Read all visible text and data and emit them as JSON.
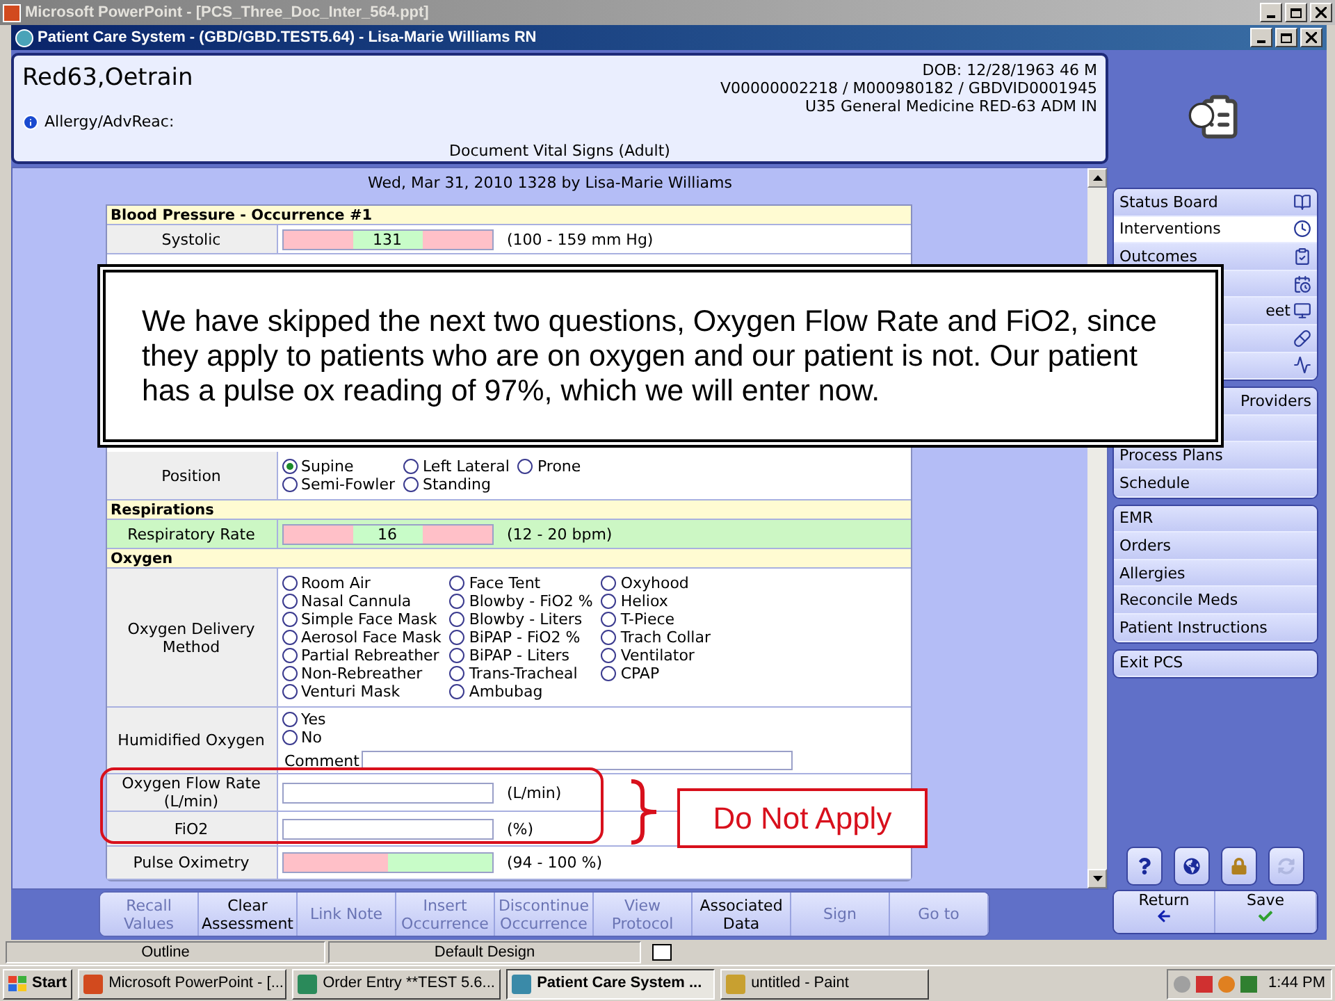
{
  "ppt_window": {
    "title": "Microsoft PowerPoint - [PCS_Three_Doc_Inter_564.ppt]"
  },
  "pcs_window": {
    "title": "Patient Care System - (GBD/GBD.TEST5.64) - Lisa-Marie Williams RN"
  },
  "patient": {
    "name": "Red63,Oetrain",
    "dob": "DOB: 12/28/1963 46 M",
    "ids": "V00000002218 / M000980182 / GBDVID0001945",
    "unit": "U35 General Medicine  RED-63  ADM IN",
    "allergy_label": "Allergy/AdvReac:",
    "document_title": "Document Vital Signs (Adult)"
  },
  "form": {
    "header": "Wed,  Mar 31, 2010 1328  by  Lisa-Marie Williams",
    "sections": [
      {
        "title": "Blood Pressure - Occurrence #1",
        "rows": [
          {
            "kind": "range_both",
            "label": "Systolic",
            "value": "131",
            "range": "(100 - 159 mm Hg)",
            "highlighted": false
          },
          {
            "kind": "radios",
            "label": "Position",
            "columns": [
              [
                {
                  "label": "Supine",
                  "selected": true
                },
                {
                  "label": "Semi-Fowler",
                  "selected": false
                }
              ],
              [
                {
                  "label": "Left Lateral",
                  "selected": false
                },
                {
                  "label": "Standing",
                  "selected": false
                }
              ],
              [
                {
                  "label": "Prone",
                  "selected": false
                }
              ]
            ]
          }
        ]
      },
      {
        "title": "Respirations",
        "rows": [
          {
            "kind": "range_both",
            "label": "Respiratory Rate",
            "value": "16",
            "range": "(12 - 20 bpm)",
            "highlighted": true
          }
        ]
      },
      {
        "title": "Oxygen",
        "rows": [
          {
            "kind": "radios",
            "label": "Oxygen Delivery Method",
            "columns": [
              [
                {
                  "label": "Room Air",
                  "selected": false
                },
                {
                  "label": "Nasal Cannula",
                  "selected": false
                },
                {
                  "label": "Simple Face Mask",
                  "selected": false
                },
                {
                  "label": "Aerosol Face Mask",
                  "selected": false
                },
                {
                  "label": "Partial Rebreather",
                  "selected": false
                },
                {
                  "label": "Non-Rebreather",
                  "selected": false
                },
                {
                  "label": "Venturi Mask",
                  "selected": false
                }
              ],
              [
                {
                  "label": "Face Tent",
                  "selected": false
                },
                {
                  "label": "Blowby - FiO2 %",
                  "selected": false
                },
                {
                  "label": "Blowby - Liters",
                  "selected": false
                },
                {
                  "label": "BiPAP - FiO2 %",
                  "selected": false
                },
                {
                  "label": "BiPAP - Liters",
                  "selected": false
                },
                {
                  "label": "Trans-Tracheal",
                  "selected": false
                },
                {
                  "label": "Ambubag",
                  "selected": false
                }
              ],
              [
                {
                  "label": "Oxyhood",
                  "selected": false
                },
                {
                  "label": "Heliox",
                  "selected": false
                },
                {
                  "label": "T-Piece",
                  "selected": false
                },
                {
                  "label": "Trach Collar",
                  "selected": false
                },
                {
                  "label": "Ventilator",
                  "selected": false
                },
                {
                  "label": "CPAP",
                  "selected": false
                }
              ]
            ]
          },
          {
            "kind": "radios_comment",
            "label": "Humidified Oxygen",
            "columns": [
              [
                {
                  "label": "Yes",
                  "selected": false
                },
                {
                  "label": "No",
                  "selected": false
                }
              ]
            ],
            "comment_label": "Comment"
          },
          {
            "kind": "input",
            "label": "Oxygen Flow Rate (L/min)",
            "unit": "(L/min)"
          },
          {
            "kind": "input",
            "label": "FiO2",
            "unit": "(%)"
          },
          {
            "kind": "range_low",
            "label": "Pulse Oximetry",
            "range": "(94 - 100 %)",
            "highlighted": false
          }
        ]
      }
    ]
  },
  "actions": [
    {
      "label": "Recall Values",
      "disabled": true
    },
    {
      "label": "Clear Assessment",
      "disabled": false
    },
    {
      "label": "Link Note",
      "disabled": true
    },
    {
      "label": "Insert Occurrence",
      "disabled": true
    },
    {
      "label": "Discontinue Occurrence",
      "disabled": true
    },
    {
      "label": "View Protocol",
      "disabled": true
    },
    {
      "label": "Associated Data",
      "disabled": false
    },
    {
      "label": "Sign",
      "disabled": true
    },
    {
      "label": "Go to",
      "disabled": true
    }
  ],
  "sidebar": {
    "groups": [
      [
        {
          "kind": "item",
          "label": "Status Board",
          "selected": false
        },
        {
          "kind": "item",
          "label": "Interventions",
          "selected": true
        },
        {
          "kind": "item",
          "label": "Outcomes",
          "selected": false
        },
        {
          "kind": "covered",
          "selected": false
        },
        {
          "kind": "partial",
          "label": "eet",
          "selected": false
        },
        {
          "kind": "covered",
          "selected": false
        },
        {
          "kind": "covered",
          "selected": false
        }
      ],
      [
        {
          "kind": "partial",
          "label": "Providers",
          "selected": false
        },
        {
          "kind": "covered",
          "selected": false
        },
        {
          "kind": "item",
          "label": "Process Plans",
          "selected": false
        },
        {
          "kind": "item",
          "label": "Schedule",
          "selected": false
        }
      ],
      [
        {
          "kind": "item",
          "label": "EMR",
          "selected": false
        },
        {
          "kind": "item",
          "label": "Orders",
          "selected": false
        },
        {
          "kind": "item",
          "label": "Allergies",
          "selected": false
        },
        {
          "kind": "item",
          "label": "Reconcile Meds",
          "selected": false
        },
        {
          "kind": "item",
          "label": "Patient Instructions",
          "selected": false
        }
      ],
      [
        {
          "kind": "item",
          "label": "Exit PCS",
          "selected": false
        }
      ]
    ]
  },
  "tools": [
    {
      "disabled": false
    },
    {
      "disabled": false
    },
    {
      "disabled": false
    },
    {
      "disabled": true
    }
  ],
  "nav_buttons": [
    {
      "label": "Return"
    },
    {
      "label": "Save"
    }
  ],
  "callout": {
    "text": "We have skipped the next two questions, Oxygen Flow Rate and FiO2, since they apply to patients who are on oxygen and our patient is not. Our patient has a pulse ox reading of 97%, which we will enter now."
  },
  "annotation": {
    "label": "Do Not Apply"
  },
  "ppt_status": [
    "Outline",
    "Default Design"
  ],
  "taskbar": {
    "start": "Start",
    "tasks": [
      {
        "label": "Microsoft PowerPoint - [...",
        "selected": false
      },
      {
        "label": "Order Entry **TEST 5.6...",
        "selected": false
      },
      {
        "label": "Patient Care System ...",
        "selected": true
      },
      {
        "label": "untitled - Paint",
        "selected": false
      }
    ],
    "clock": "1:44 PM"
  }
}
